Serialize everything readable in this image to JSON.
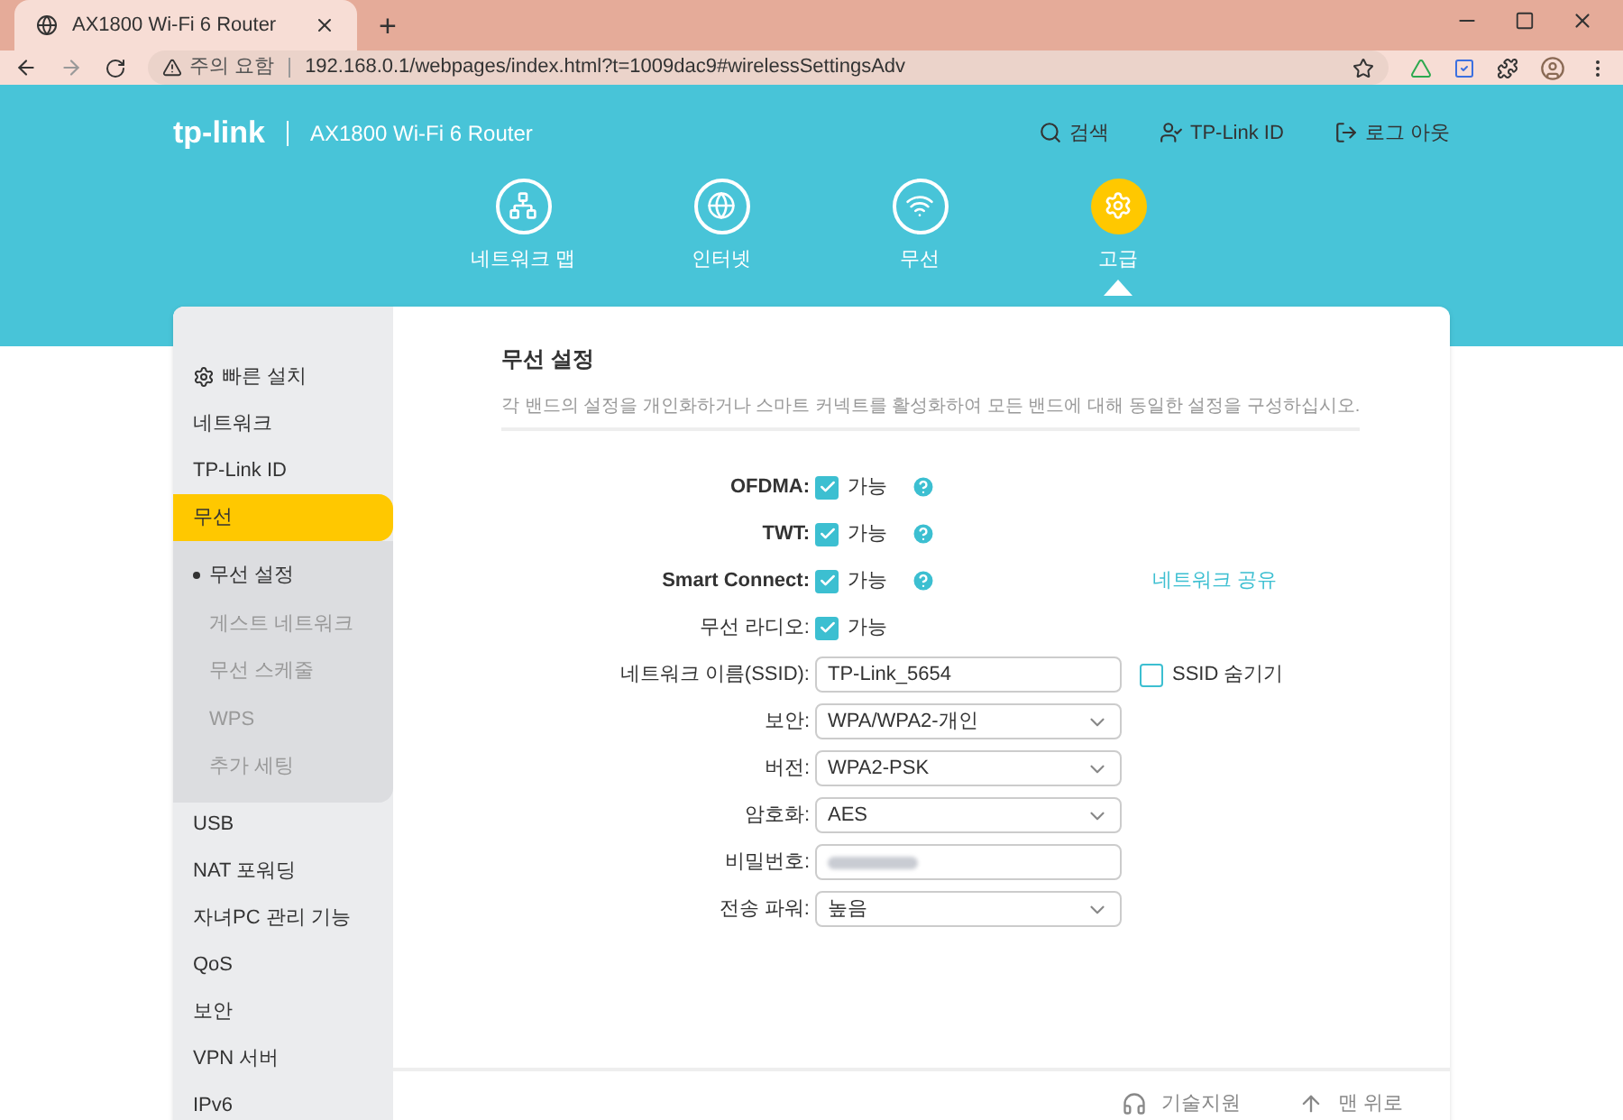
{
  "browser": {
    "tab_title": "AX1800 Wi-Fi 6 Router",
    "new_tab": "+",
    "warning": "주의 요함",
    "url": "192.168.0.1/webpages/index.html?t=1009dac9#wirelessSettingsAdv"
  },
  "header": {
    "brand": "tp-link",
    "model": "AX1800 Wi-Fi 6 Router",
    "links": [
      {
        "kind": "search",
        "label": "검색"
      },
      {
        "kind": "id",
        "label": "TP-Link ID"
      },
      {
        "kind": "logout",
        "label": "로그 아웃"
      }
    ],
    "nav": [
      {
        "kind": "network",
        "label": "네트워크 맵",
        "selected": false
      },
      {
        "kind": "internet",
        "label": "인터넷",
        "selected": false
      },
      {
        "kind": "wireless",
        "label": "무선",
        "selected": false
      },
      {
        "kind": "advanced",
        "label": "고급",
        "selected": true
      }
    ]
  },
  "sidebar": [
    {
      "label": "빠른 설치",
      "selected": false,
      "kind": "quick"
    },
    {
      "label": "네트워크",
      "selected": false
    },
    {
      "label": "TP-Link ID",
      "selected": false
    },
    {
      "label": "무선",
      "selected": true,
      "children": [
        {
          "label": "무선 설정",
          "selected": true
        },
        {
          "label": "게스트 네트워크",
          "selected": false
        },
        {
          "label": "무선 스케줄",
          "selected": false
        },
        {
          "label": "WPS",
          "selected": false
        },
        {
          "label": "추가 세팅",
          "selected": false
        }
      ]
    },
    {
      "label": "USB",
      "selected": false
    },
    {
      "label": "NAT 포워딩",
      "selected": false
    },
    {
      "label": "자녀PC 관리 기능",
      "selected": false
    },
    {
      "label": "QoS",
      "selected": false
    },
    {
      "label": "보안",
      "selected": false
    },
    {
      "label": "VPN 서버",
      "selected": false
    },
    {
      "label": "IPv6",
      "selected": false
    }
  ],
  "content": {
    "title": "무선 설정",
    "description": "각 밴드의 설정을 개인화하거나 스마트 커넥트를 활성화하여 모든 밴드에 대해 동일한 설정을 구성하십시오.",
    "rows": [
      {
        "kind": "checkbox",
        "label": "OFDMA:",
        "bold": true,
        "checked": true,
        "text": "가능",
        "help": true
      },
      {
        "kind": "checkbox",
        "label": "TWT:",
        "bold": true,
        "checked": true,
        "text": "가능",
        "help": true
      },
      {
        "kind": "checkbox",
        "label": "Smart Connect:",
        "bold": true,
        "checked": true,
        "text": "가능",
        "help": true,
        "link": "네트워크 공유"
      },
      {
        "kind": "checkbox",
        "label": "무선 라디오:",
        "bold": false,
        "checked": true,
        "text": "가능",
        "help": false
      },
      {
        "kind": "text",
        "label": "네트워크 이름(SSID):",
        "bold": false,
        "value": "TP-Link_5654",
        "side": {
          "text": "SSID 숨기기",
          "checked": false
        }
      },
      {
        "kind": "select",
        "label": "보안:",
        "bold": false,
        "value": "WPA/WPA2-개인"
      },
      {
        "kind": "select",
        "label": "버전:",
        "bold": false,
        "value": "WPA2-PSK"
      },
      {
        "kind": "select",
        "label": "암호화:",
        "bold": false,
        "value": "AES"
      },
      {
        "kind": "password",
        "label": "비밀번호:",
        "bold": false
      },
      {
        "kind": "select",
        "label": "전송 파워:",
        "bold": false,
        "value": "높음"
      }
    ]
  },
  "footer": [
    {
      "kind": "support",
      "label": "기술지원"
    },
    {
      "kind": "top",
      "label": "맨 위로"
    }
  ]
}
